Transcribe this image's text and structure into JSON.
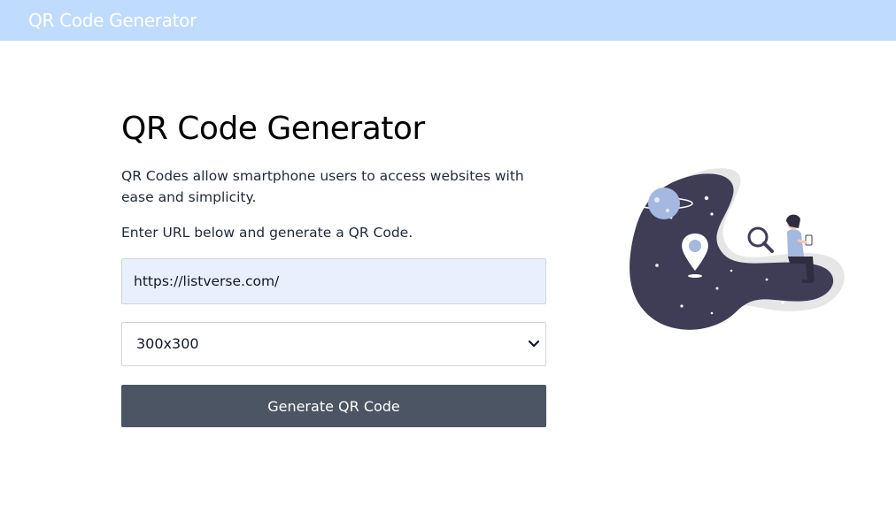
{
  "header": {
    "title": "QR Code Generator"
  },
  "main": {
    "heading": "QR Code Generator",
    "intro": "QR Codes allow smartphone users to access websites with ease and simplicity.",
    "instruction": "Enter URL below and generate a QR Code.",
    "url_input": {
      "value": "https://listverse.com/",
      "placeholder": ""
    },
    "size_select": {
      "value": "300x300"
    },
    "generate_label": "Generate QR Code"
  },
  "colors": {
    "header_bg": "#bfdbfe",
    "input_bg": "#e8f0fe",
    "button_bg": "#4b5563",
    "illustration_dark": "#3f3d56",
    "illustration_accent": "#a4b8e0"
  },
  "icons": {
    "select_arrow": "chevron-down-icon",
    "illustration": "qr-scan-illustration"
  }
}
